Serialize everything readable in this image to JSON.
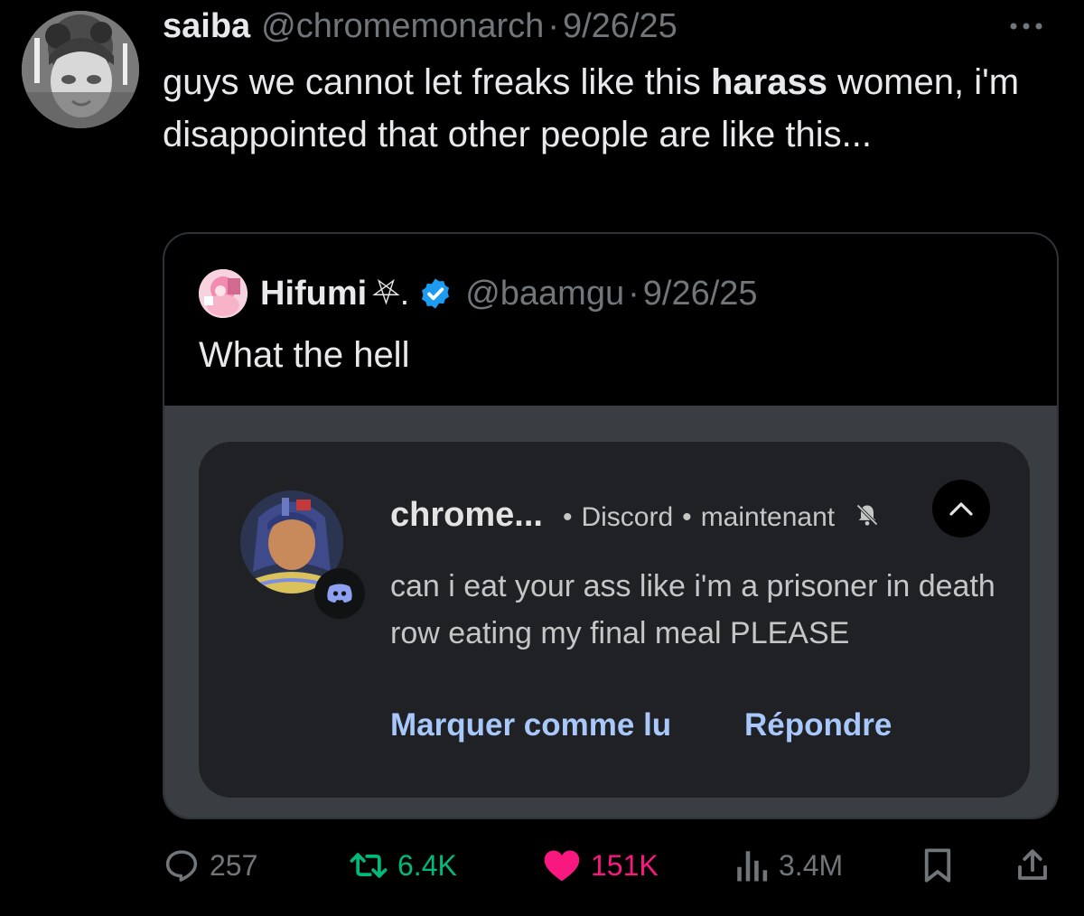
{
  "colors": {
    "background": "#000000",
    "text_primary": "#e7e9ea",
    "text_secondary": "#71767b",
    "retweet_green": "#00ba7c",
    "like_pink": "#f91880",
    "verified_blue": "#1d9bf0",
    "link_blue": "#a8c7fa",
    "notification_bg": "#202124"
  },
  "tweet": {
    "display_name": "saiba",
    "handle": "@chromemonarch",
    "separator": "·",
    "date": "9/26/25",
    "text_before_bold": "guys we cannot let freaks like this ",
    "text_bold": "harass",
    "text_after_bold": " women, i'm disappointed that other people are like this..."
  },
  "quote": {
    "display_name": "Hifumi",
    "name_decoration": "⛧.",
    "verified": true,
    "handle": "@baamgu",
    "separator": "·",
    "date": "9/26/25",
    "text": "What the hell"
  },
  "notification": {
    "sender": "chrome...",
    "bullet": "•",
    "app": "Discord",
    "time": "maintenant",
    "message": "can i eat your ass like i'm a prisoner in death row eating my final meal PLEASE",
    "action_mark_read": "Marquer comme lu",
    "action_reply": "Répondre"
  },
  "actions": {
    "replies": "257",
    "retweets": "6.4K",
    "likes": "151K",
    "views": "3.4M",
    "icons": [
      "reply-icon",
      "retweet-icon",
      "heart-icon",
      "views-icon",
      "bookmark-icon",
      "share-icon"
    ]
  }
}
